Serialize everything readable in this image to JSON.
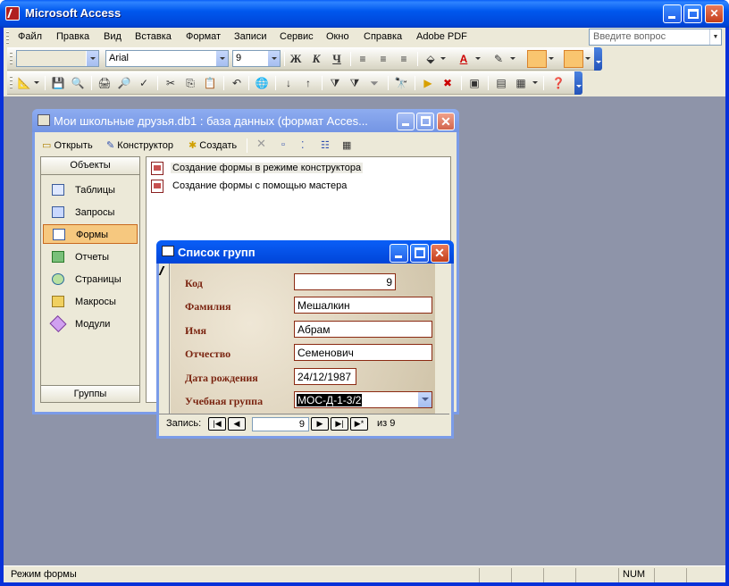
{
  "app": {
    "title": "Microsoft Access"
  },
  "menu": {
    "items": [
      "Файл",
      "Правка",
      "Вид",
      "Вставка",
      "Формат",
      "Записи",
      "Сервис",
      "Окно",
      "Справка",
      "Adobe PDF"
    ],
    "help_placeholder": "Введите вопрос"
  },
  "format_toolbar": {
    "object_combo": "",
    "font_combo": "Arial",
    "size_combo": "9",
    "bold": "Ж",
    "italic": "К",
    "underline": "Ч"
  },
  "db_window": {
    "title": "Мои школьные друзья.db1 : база данных (формат Acces...",
    "toolbar": {
      "open": "Открыть",
      "design": "Конструктор",
      "create": "Создать"
    },
    "objects_header": "Объекты",
    "groups_footer": "Группы",
    "objects": [
      "Таблицы",
      "Запросы",
      "Формы",
      "Отчеты",
      "Страницы",
      "Макросы",
      "Модули"
    ],
    "selected_object": "Формы",
    "list": [
      "Создание формы в режиме конструктора",
      "Создание формы с помощью мастера"
    ]
  },
  "form_window": {
    "title": "Список групп",
    "fields": [
      {
        "label": "Код",
        "value": "9"
      },
      {
        "label": "Фамилия",
        "value": "Мешалкин"
      },
      {
        "label": "Имя",
        "value": "Абрам"
      },
      {
        "label": "Отчество",
        "value": "Семенович"
      },
      {
        "label": "Дата рождения",
        "value": "24/12/1987"
      },
      {
        "label": "Учебная группа",
        "value": "МОС-Д-1-3/2"
      }
    ],
    "nav": {
      "record_label": "Запись:",
      "current": "9",
      "of_label": "из 9"
    }
  },
  "status": {
    "text": "Режим формы",
    "num": "NUM"
  },
  "colors": {
    "title_blue": "#0054e3",
    "mdi_bg": "#8e94a9",
    "label_red": "#7a2410",
    "selected_orange": "#f6c87f"
  }
}
